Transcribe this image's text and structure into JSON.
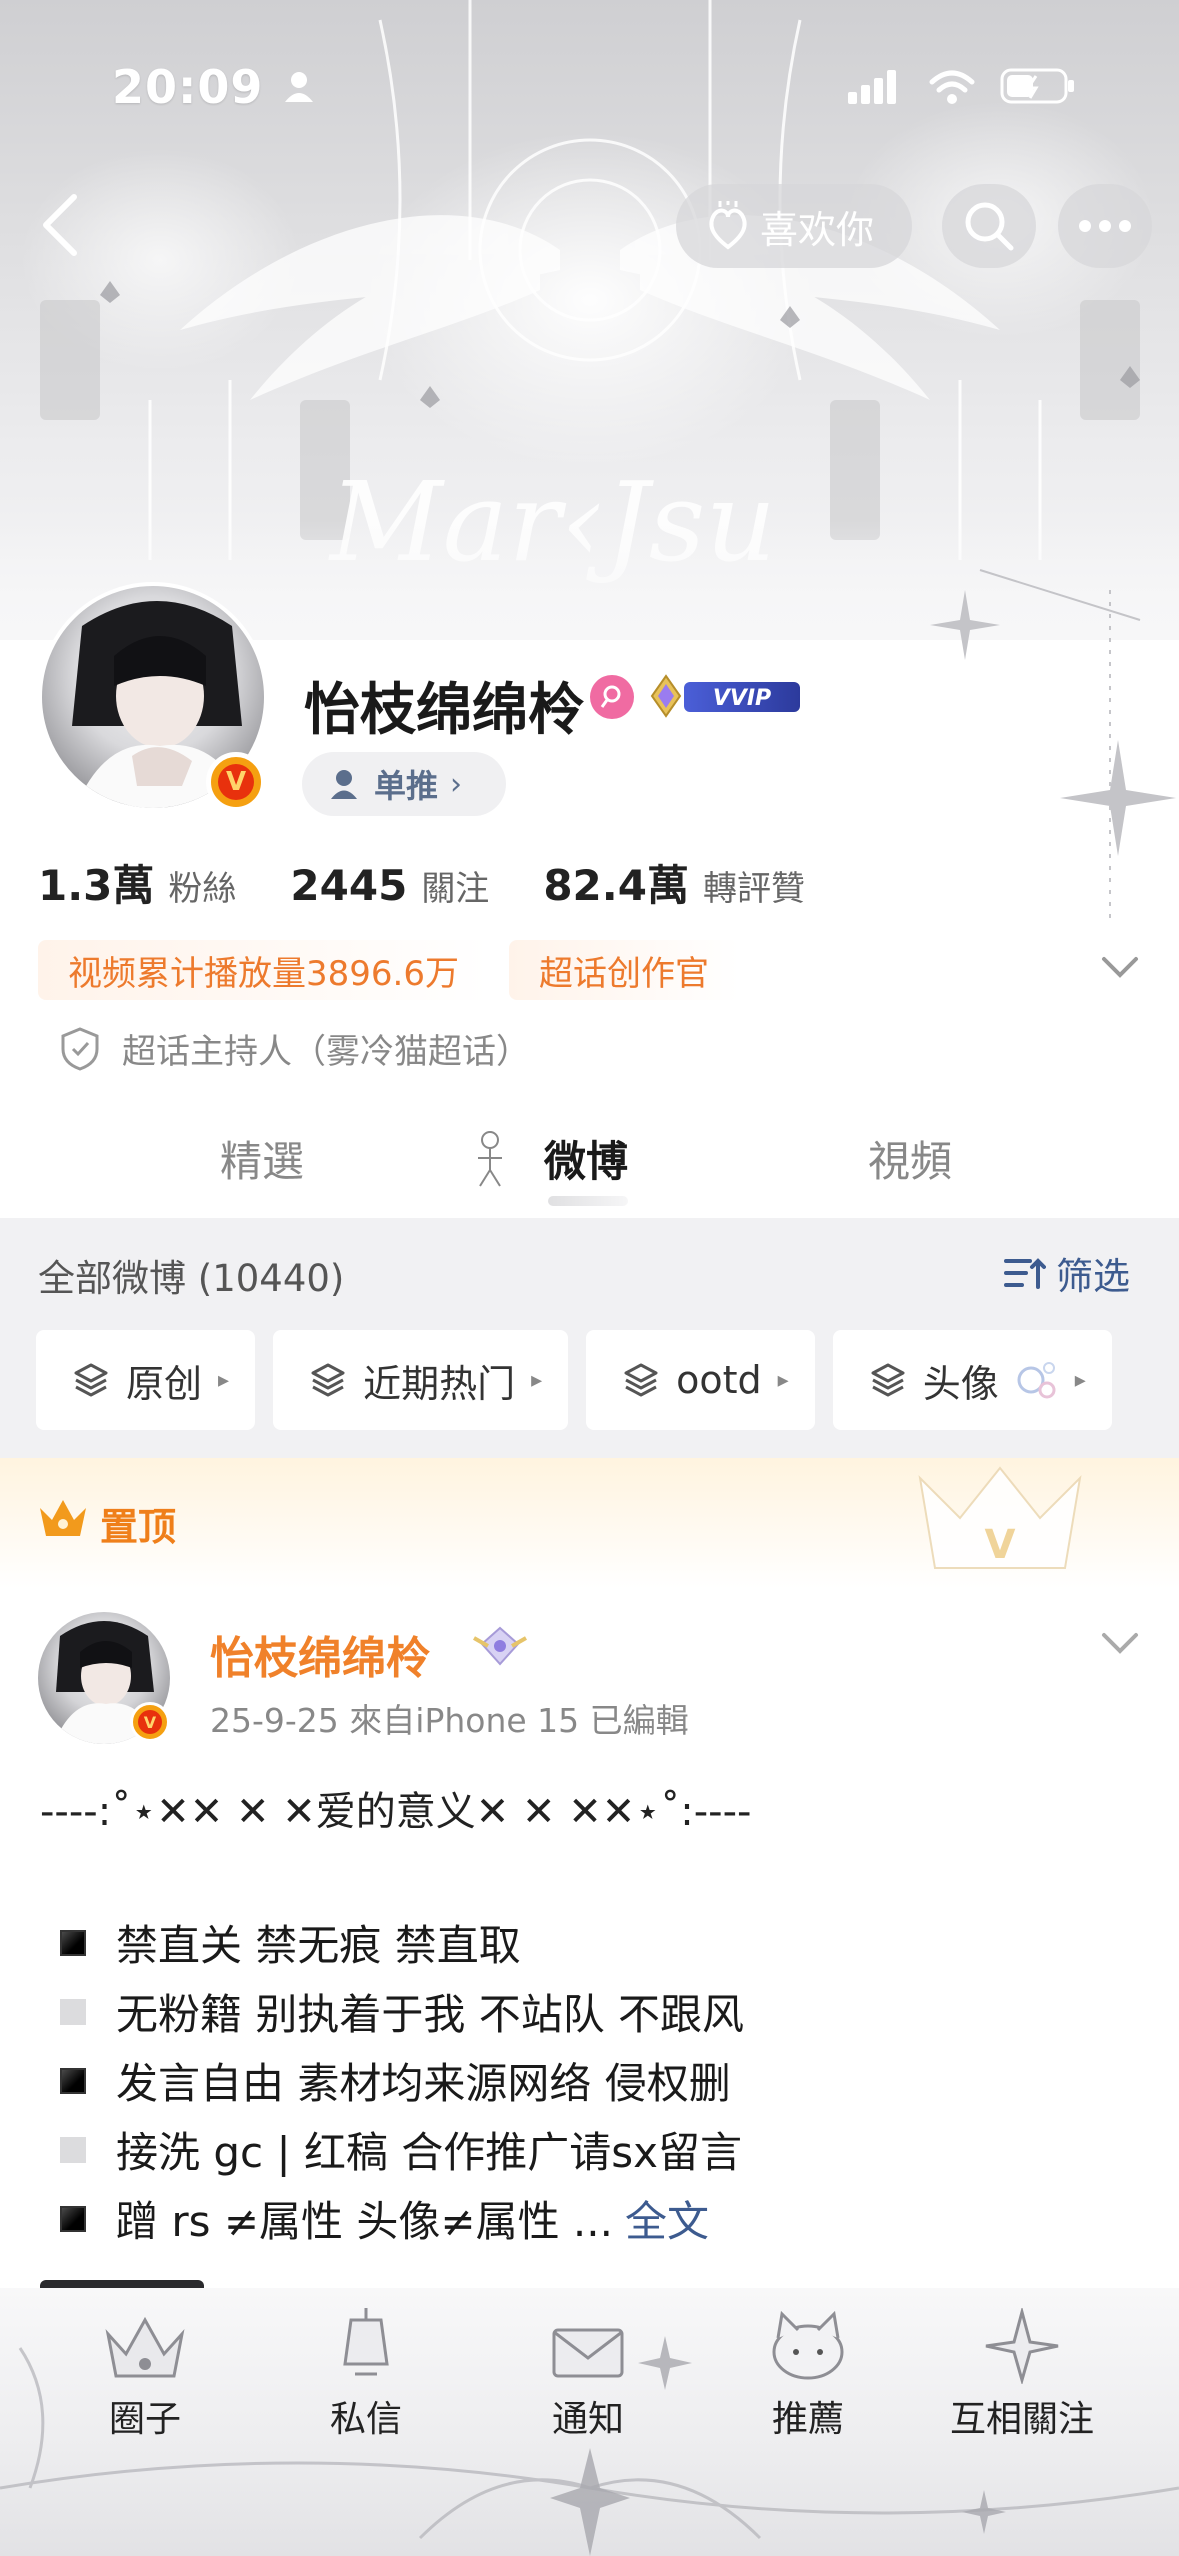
{
  "status_bar": {
    "time": "20:09"
  },
  "top_nav": {
    "like_label": "喜欢你"
  },
  "profile": {
    "name": "怡枝绵绵柃",
    "vip_label": "VVIP",
    "single_label": "单推",
    "stats": [
      {
        "value": "1.3萬",
        "label": "粉絲"
      },
      {
        "value": "2445",
        "label": "關注"
      },
      {
        "value": "82.4萬",
        "label": "轉評贊"
      }
    ],
    "tags": [
      "视频累计播放量3896.6万",
      "超话创作官"
    ],
    "host_text": "超话主持人（雾冷猫超话）"
  },
  "tabs": [
    {
      "label": "精選",
      "active": false
    },
    {
      "label": "微博",
      "active": true
    },
    {
      "label": "視頻",
      "active": false
    }
  ],
  "filter": {
    "all_posts": "全部微博 (10440)",
    "filter_label": "筛选",
    "chips": [
      "原创",
      "近期热门",
      "ootd",
      "头像"
    ]
  },
  "pinned": {
    "label": "置顶"
  },
  "post": {
    "author": "怡枝绵绵柃",
    "meta": "25-9-25  來自iPhone 15  已編輯",
    "title_line": "----:˚⋆✕✕ ✕ ✕爱的意义✕ ✕ ✕✕⋆˚:----",
    "lines": [
      {
        "style": "black",
        "text": "禁直关  禁无痕  禁直取"
      },
      {
        "style": "grey",
        "text": "无粉籍 别执着于我 不站队 不跟风"
      },
      {
        "style": "black",
        "text": "发言自由 素材均来源网络 侵权删"
      },
      {
        "style": "grey",
        "text": "接洗 gc | 红稿  合作推广请sx留言"
      },
      {
        "style": "black",
        "text": "蹭 rs ≠属性 头像≠属性 ..."
      }
    ],
    "full_text_link": "全文"
  },
  "bottom_nav": [
    "圈子",
    "私信",
    "通知",
    "推薦",
    "互相關注"
  ],
  "colors": {
    "accent_orange": "#ef7f1a",
    "link_blue": "#3d5b8f",
    "verified_orange": "#f5a011"
  }
}
